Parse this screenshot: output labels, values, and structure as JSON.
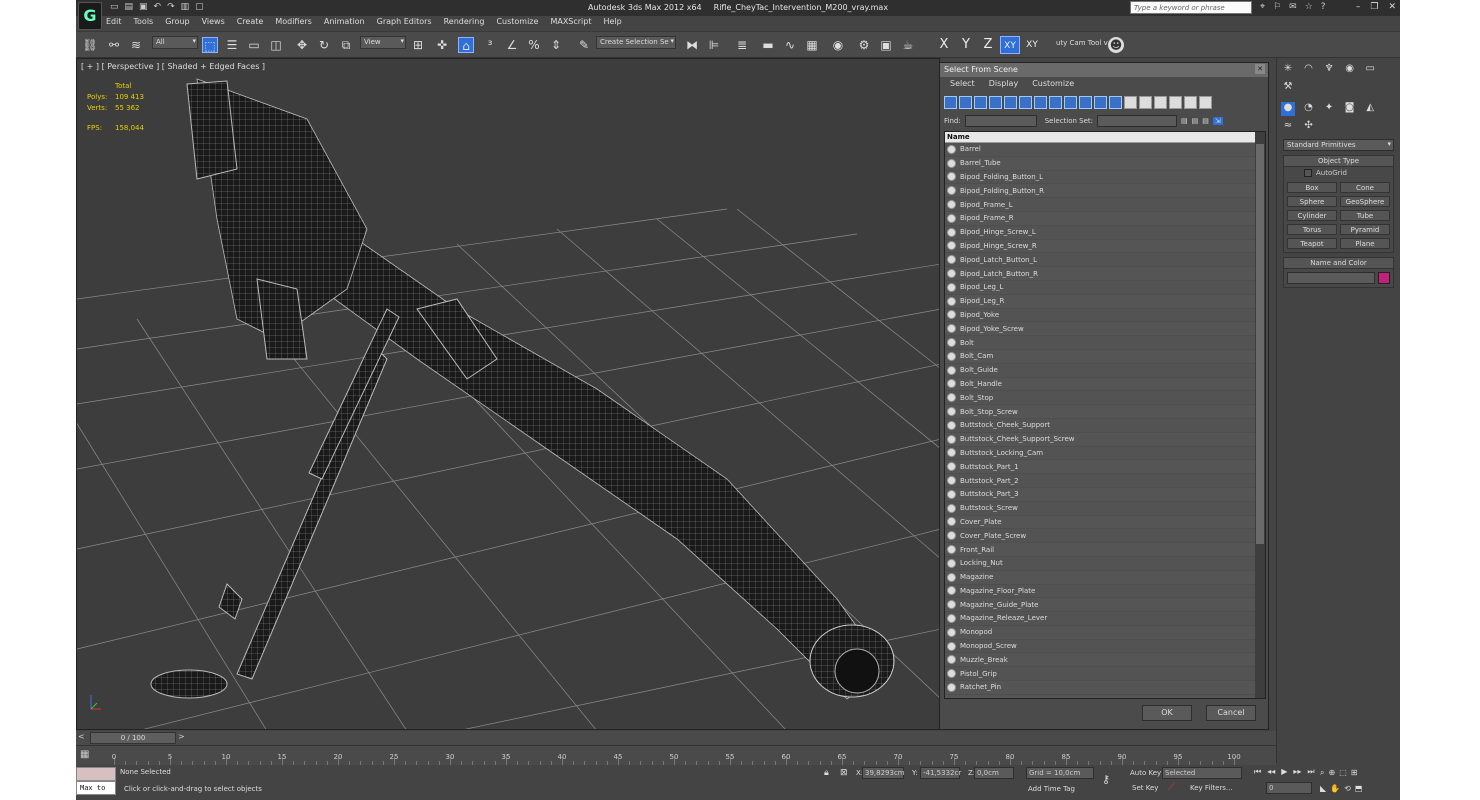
{
  "app": {
    "title": "Autodesk 3ds Max  2012 x64",
    "file": "Rifle_CheyTac_Intervention_M200_vray.max",
    "search_placeholder": "Type a keyword or phrase"
  },
  "menu": [
    "Edit",
    "Tools",
    "Group",
    "Views",
    "Create",
    "Modifiers",
    "Animation",
    "Graph Editors",
    "Rendering",
    "Customize",
    "MAXScript",
    "Help"
  ],
  "toolbar": {
    "filter": "All",
    "refcoord": "View",
    "selection_set": "Create Selection Se",
    "axes": [
      "X",
      "Y",
      "Z",
      "XY",
      "XY"
    ],
    "cam_tool": "uty Cam Tool v"
  },
  "viewport": {
    "label": "[ + ] [ Perspective ] [ Shaded + Edged Faces ]",
    "stats_header": "Total",
    "polys_label": "Polys:",
    "polys": "109 413",
    "verts_label": "Verts:",
    "verts": "55 362",
    "fps_label": "FPS:",
    "fps": "158,044"
  },
  "dialog": {
    "title": "Select From Scene",
    "menu": [
      "Select",
      "Display",
      "Customize"
    ],
    "find_label": "Find:",
    "selset_label": "Selection Set:",
    "column": "Name",
    "items": [
      "Barrel",
      "Barrel_Tube",
      "Bipod_Folding_Button_L",
      "Bipod_Folding_Button_R",
      "Bipod_Frame_L",
      "Bipod_Frame_R",
      "Bipod_Hinge_Screw_L",
      "Bipod_Hinge_Screw_R",
      "Bipod_Latch_Button_L",
      "Bipod_Latch_Button_R",
      "Bipod_Leg_L",
      "Bipod_Leg_R",
      "Bipod_Yoke",
      "Bipod_Yoke_Screw",
      "Bolt",
      "Bolt_Cam",
      "Bolt_Guide",
      "Bolt_Handle",
      "Bolt_Stop",
      "Bolt_Stop_Screw",
      "Buttstock_Cheek_Support",
      "Buttstock_Cheek_Support_Screw",
      "Buttstock_Locking_Cam",
      "Buttstock_Part_1",
      "Buttstock_Part_2",
      "Buttstock_Part_3",
      "Buttstock_Screw",
      "Cover_Plate",
      "Cover_Plate_Screw",
      "Front_Rail",
      "Locking_Nut",
      "Magazine",
      "Magazine_Floor_Plate",
      "Magazine_Guide_Plate",
      "Magazine_Releaze_Lever",
      "Monopod",
      "Monopod_Screw",
      "Muzzle_Break",
      "Pistol_Grip",
      "Ratchet_Pin"
    ],
    "ok": "OK",
    "cancel": "Cancel"
  },
  "command_panel": {
    "dropdown": "Standard Primitives",
    "object_type": "Object Type",
    "autogrid": "AutoGrid",
    "buttons": [
      "Box",
      "Cone",
      "Sphere",
      "GeoSphere",
      "Cylinder",
      "Tube",
      "Torus",
      "Pyramid",
      "Teapot",
      "Plane"
    ],
    "name_color": "Name and Color",
    "swatch": "#c2207a"
  },
  "timeline": {
    "frame": "0 / 100",
    "ticks": [
      "0",
      "5",
      "10",
      "15",
      "20",
      "25",
      "30",
      "35",
      "40",
      "45",
      "50",
      "55",
      "60",
      "65",
      "70",
      "75",
      "80",
      "85",
      "90",
      "95",
      "100"
    ]
  },
  "status": {
    "maxscript": "Max to",
    "selection": "None Selected",
    "prompt": "Click or click-and-drag to select objects",
    "x_label": "X:",
    "x": "39,8293cm",
    "y_label": "Y:",
    "y": "-41,5332cr",
    "z_label": "Z:",
    "z": "0,0cm",
    "grid": "Grid = 10,0cm",
    "auto_key": "Auto Key",
    "key_mode": "Selected",
    "set_key": "Set Key",
    "key_filters": "Key Filters...",
    "add_time_tag": "Add Time Tag",
    "frame_field": "0"
  }
}
